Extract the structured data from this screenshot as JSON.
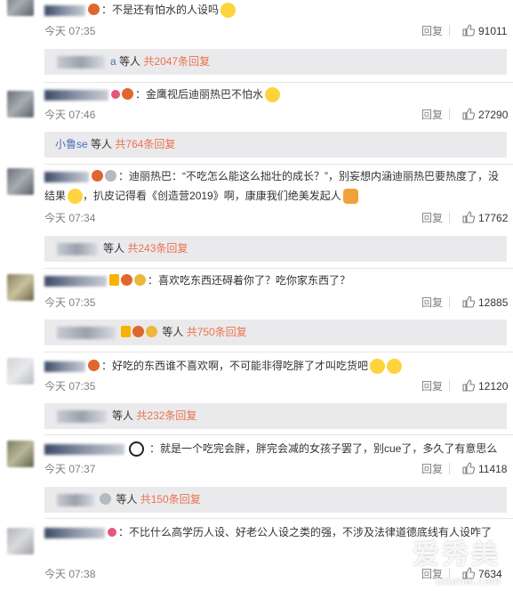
{
  "comments": [
    {
      "text": "：不是还有怕水的人设吗",
      "time": "今天 07:35",
      "reply": "回复",
      "likes": "91011",
      "thread": {
        "prefix": "a",
        "label": "等人",
        "count": "共2047条回复"
      }
    },
    {
      "text": "：金鹰视后迪丽热巴不怕水",
      "time": "今天 07:46",
      "reply": "回复",
      "likes": "27290",
      "thread": {
        "prefix": "小鲁se",
        "label": "等人",
        "count": "共764条回复"
      }
    },
    {
      "text": "：迪丽热巴：“不吃怎么能这么拙壮的成长？”，别妄想内涵迪丽热巴要热度了，没结果",
      "text2": "，扒皮记得看《创造营2019》啊，康康我们绝美发起人",
      "time": "今天 07:34",
      "reply": "回复",
      "likes": "17762",
      "thread": {
        "prefix": "",
        "label": "等人",
        "count": "共243条回复"
      }
    },
    {
      "text": "：喜欢吃东西还碍着你了？吃你家东西了？",
      "time": "今天 07:35",
      "reply": "回复",
      "likes": "12885",
      "thread": {
        "prefix": "",
        "label": "等人",
        "count": "共750条回复"
      }
    },
    {
      "text": "：好吃的东西谁不喜欢啊，不可能非得吃胖了才叫吃货吧",
      "time": "今天 07:35",
      "reply": "回复",
      "likes": "12120",
      "thread": {
        "prefix": "",
        "label": "等人",
        "count": "共232条回复"
      }
    },
    {
      "text": "：就是一个吃完会胖，胖完会减的女孩子罢了，别cue了，多久了有意思么",
      "time": "今天 07:37",
      "reply": "回复",
      "likes": "11418",
      "thread": {
        "prefix": "",
        "label": "等人",
        "count": "共150条回复"
      }
    },
    {
      "text": "：不比什么高学历人设、好老公人设之类的强，不涉及法律道德底线有人设咋了",
      "time": "今天 07:38",
      "reply": "回复",
      "likes": "7634"
    }
  ],
  "watermark": {
    "text": "爱秀美",
    "url": "ixiumei.com"
  },
  "colors": {
    "link": "#eb7350",
    "blue_link": "#4a6db8",
    "reply_bg": "#eaeaec"
  },
  "icons": {
    "like": "thumbs-up-icon",
    "avatar": "avatar",
    "badge": "member-badge-icon"
  }
}
